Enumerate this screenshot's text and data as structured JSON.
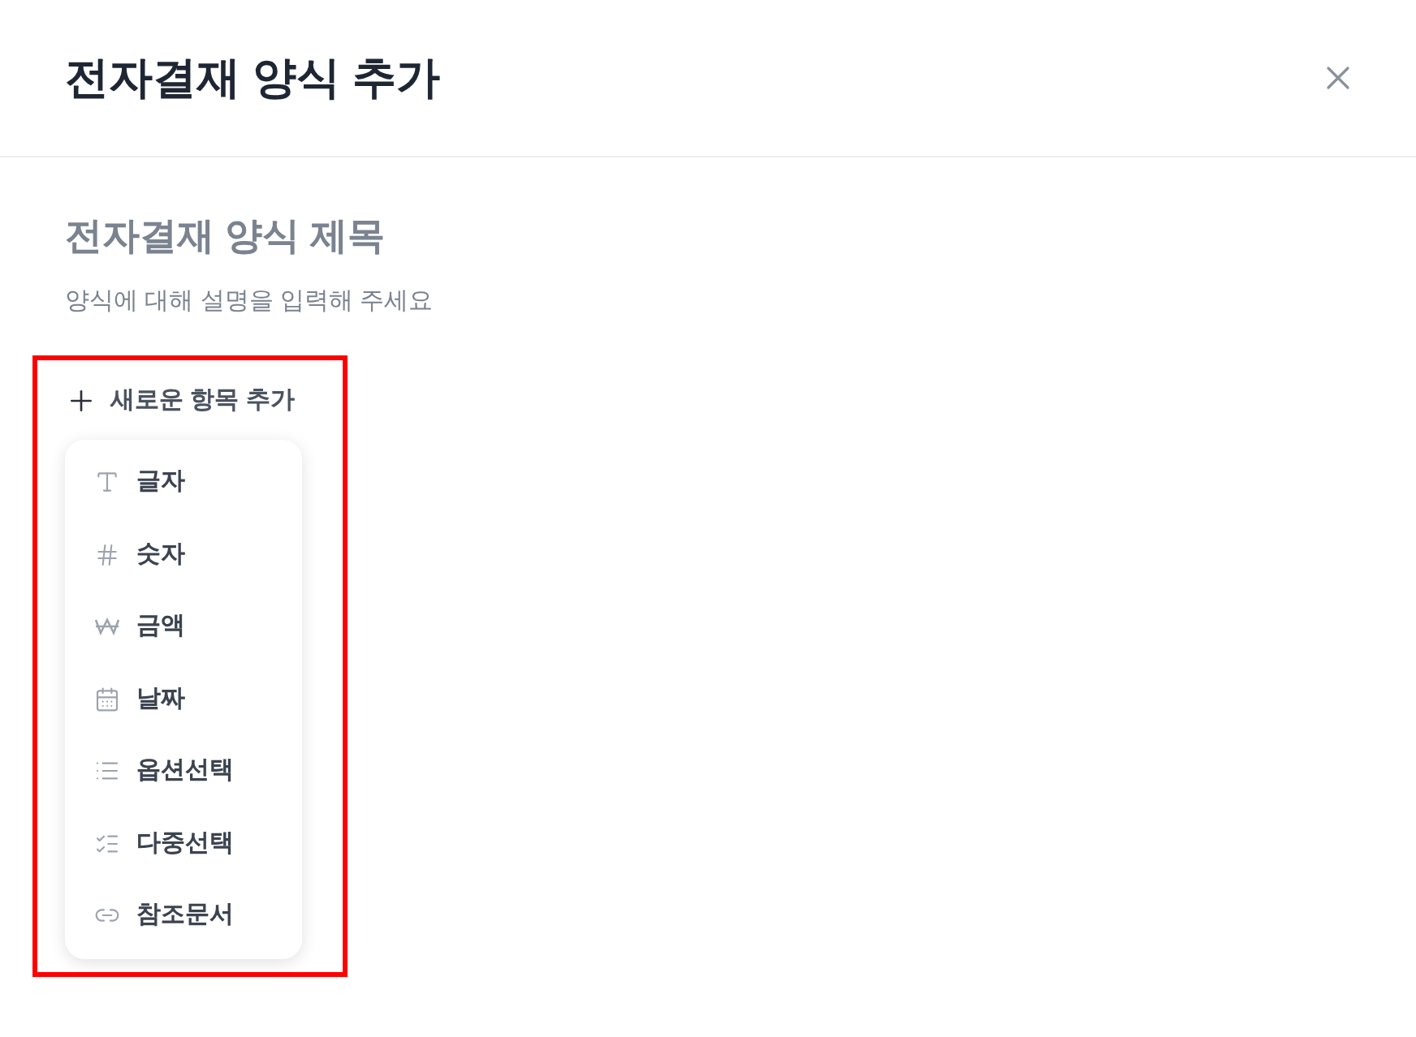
{
  "dialog": {
    "title": "전자결재 양식 추가"
  },
  "form": {
    "title_placeholder": "전자결재 양식 제목",
    "description_placeholder": "양식에 대해 설명을 입력해 주세요"
  },
  "add_item_button": "새로운 항목 추가",
  "menu": [
    {
      "kind": "text",
      "label": "글자"
    },
    {
      "kind": "number",
      "label": "숫자"
    },
    {
      "kind": "amount",
      "label": "금액"
    },
    {
      "kind": "date",
      "label": "날짜"
    },
    {
      "kind": "option",
      "label": "옵션선택"
    },
    {
      "kind": "multi",
      "label": "다중선택"
    },
    {
      "kind": "reference",
      "label": "참조문서"
    }
  ]
}
